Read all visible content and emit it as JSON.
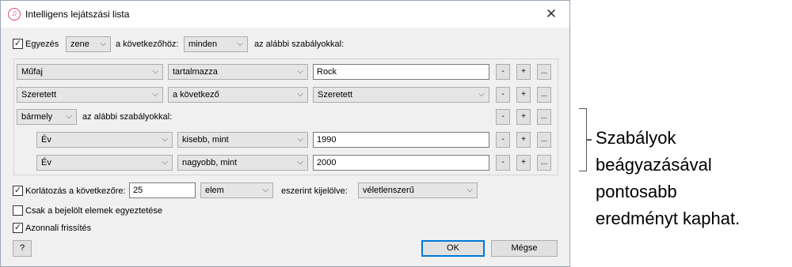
{
  "window": {
    "title": "Intelligens lejátszási lista",
    "close": "✕",
    "icon": "♫"
  },
  "match": {
    "checked": true,
    "label": "Egyezés",
    "kind": "zene",
    "following_label": "a következőhöz:",
    "scope": "minden",
    "rules_label": "az alábbi szabályokkal:"
  },
  "rules": [
    {
      "field": "Műfaj",
      "operator": "tartalmazza",
      "value": "Rock"
    },
    {
      "field": "Szeretett",
      "operator": "a következő",
      "value": "Szeretett"
    }
  ],
  "nested": {
    "scope": "bármely",
    "label": "az alábbi szabályokkal:",
    "rules": [
      {
        "field": "Év",
        "operator": "kisebb, mint",
        "value": "1990"
      },
      {
        "field": "Év",
        "operator": "nagyobb, mint",
        "value": "2000"
      }
    ]
  },
  "rule_buttons": {
    "remove": "-",
    "add": "+",
    "more": "..."
  },
  "limit": {
    "checked": true,
    "label": "Korlátozás a következőre:",
    "amount": "25",
    "unit": "elem",
    "selected_by_label": "eszerint kijelölve:",
    "selected_by": "véletlenszerű"
  },
  "checked_only": {
    "checked": false,
    "label": "Csak a bejelölt elemek egyeztetése"
  },
  "live_update": {
    "checked": true,
    "label": "Azonnali frissítés"
  },
  "buttons": {
    "help": "?",
    "ok": "OK",
    "cancel": "Mégse"
  },
  "callout": [
    "Szabályok",
    "beágyazásával",
    "pontosabb",
    "eredményt kaphat."
  ],
  "icons": {
    "checkmark": "✓",
    "chevron": "⌵"
  }
}
